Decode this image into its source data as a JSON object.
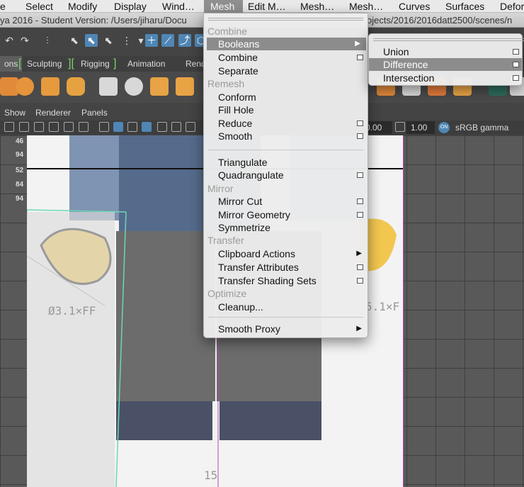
{
  "menubar": {
    "items": [
      "e",
      "Select",
      "Modify",
      "Display",
      "Wind…",
      "Mesh",
      "Edit M…",
      "Mesh…",
      "Mesh…",
      "Curves",
      "Surfaces",
      "Defor"
    ]
  },
  "titlebar": {
    "left": "ya 2016 - Student Version: /Users/jiharu/Docu",
    "right": "ojects/2016/2016datt2500/scenes/n"
  },
  "shelf_tabs": [
    "ons",
    "Sculpting",
    "Rigging",
    "Animation",
    "Rend"
  ],
  "panel_menu": [
    "Show",
    "Renderer",
    "Panels"
  ],
  "panel_toolbar": {
    "field1": "0.00",
    "field2": "1.00",
    "color_space": "sRGB gamma",
    "on_label": "ON"
  },
  "viewport": {
    "row_labels": [
      "46",
      "94",
      "52",
      "84",
      "94"
    ],
    "annotation_left": "Ø3.1×FF",
    "annotation_right": "5.1×F",
    "annotation_bottom": "15"
  },
  "mesh_menu": {
    "items": [
      {
        "type": "header",
        "label": "Combine"
      },
      {
        "type": "item",
        "label": "Booleans",
        "submenu": true,
        "highlighted": true
      },
      {
        "type": "item",
        "label": "Combine",
        "option": true
      },
      {
        "type": "item",
        "label": "Separate"
      },
      {
        "type": "header",
        "label": "Remesh"
      },
      {
        "type": "item",
        "label": "Conform"
      },
      {
        "type": "item",
        "label": "Fill Hole"
      },
      {
        "type": "item",
        "label": "Reduce",
        "option": true
      },
      {
        "type": "item",
        "label": "Smooth",
        "option": true
      },
      {
        "type": "item",
        "label": "Triangulate"
      },
      {
        "type": "item",
        "label": "Quadrangulate",
        "option": true
      },
      {
        "type": "header",
        "label": "Mirror"
      },
      {
        "type": "item",
        "label": "Mirror Cut",
        "option": true
      },
      {
        "type": "item",
        "label": "Mirror Geometry",
        "option": true
      },
      {
        "type": "item",
        "label": "Symmetrize"
      },
      {
        "type": "header",
        "label": "Transfer"
      },
      {
        "type": "item",
        "label": "Clipboard Actions",
        "submenu": true
      },
      {
        "type": "item",
        "label": "Transfer Attributes",
        "option": true
      },
      {
        "type": "item",
        "label": "Transfer Shading Sets",
        "option": true
      },
      {
        "type": "header",
        "label": "Optimize"
      },
      {
        "type": "item",
        "label": "Cleanup..."
      },
      {
        "type": "item",
        "label": "Smooth Proxy",
        "submenu": true
      }
    ]
  },
  "booleans_submenu": {
    "items": [
      {
        "label": "Union",
        "option": true
      },
      {
        "label": "Difference",
        "option": true,
        "highlighted": true
      },
      {
        "label": "Intersection",
        "option": true
      }
    ]
  },
  "colors": {
    "menu_highlight": "#8c8c8c",
    "viewport_bg": "#595959",
    "accent_blue": "#4f86b5",
    "rigging_bracket": "#78d26a"
  }
}
